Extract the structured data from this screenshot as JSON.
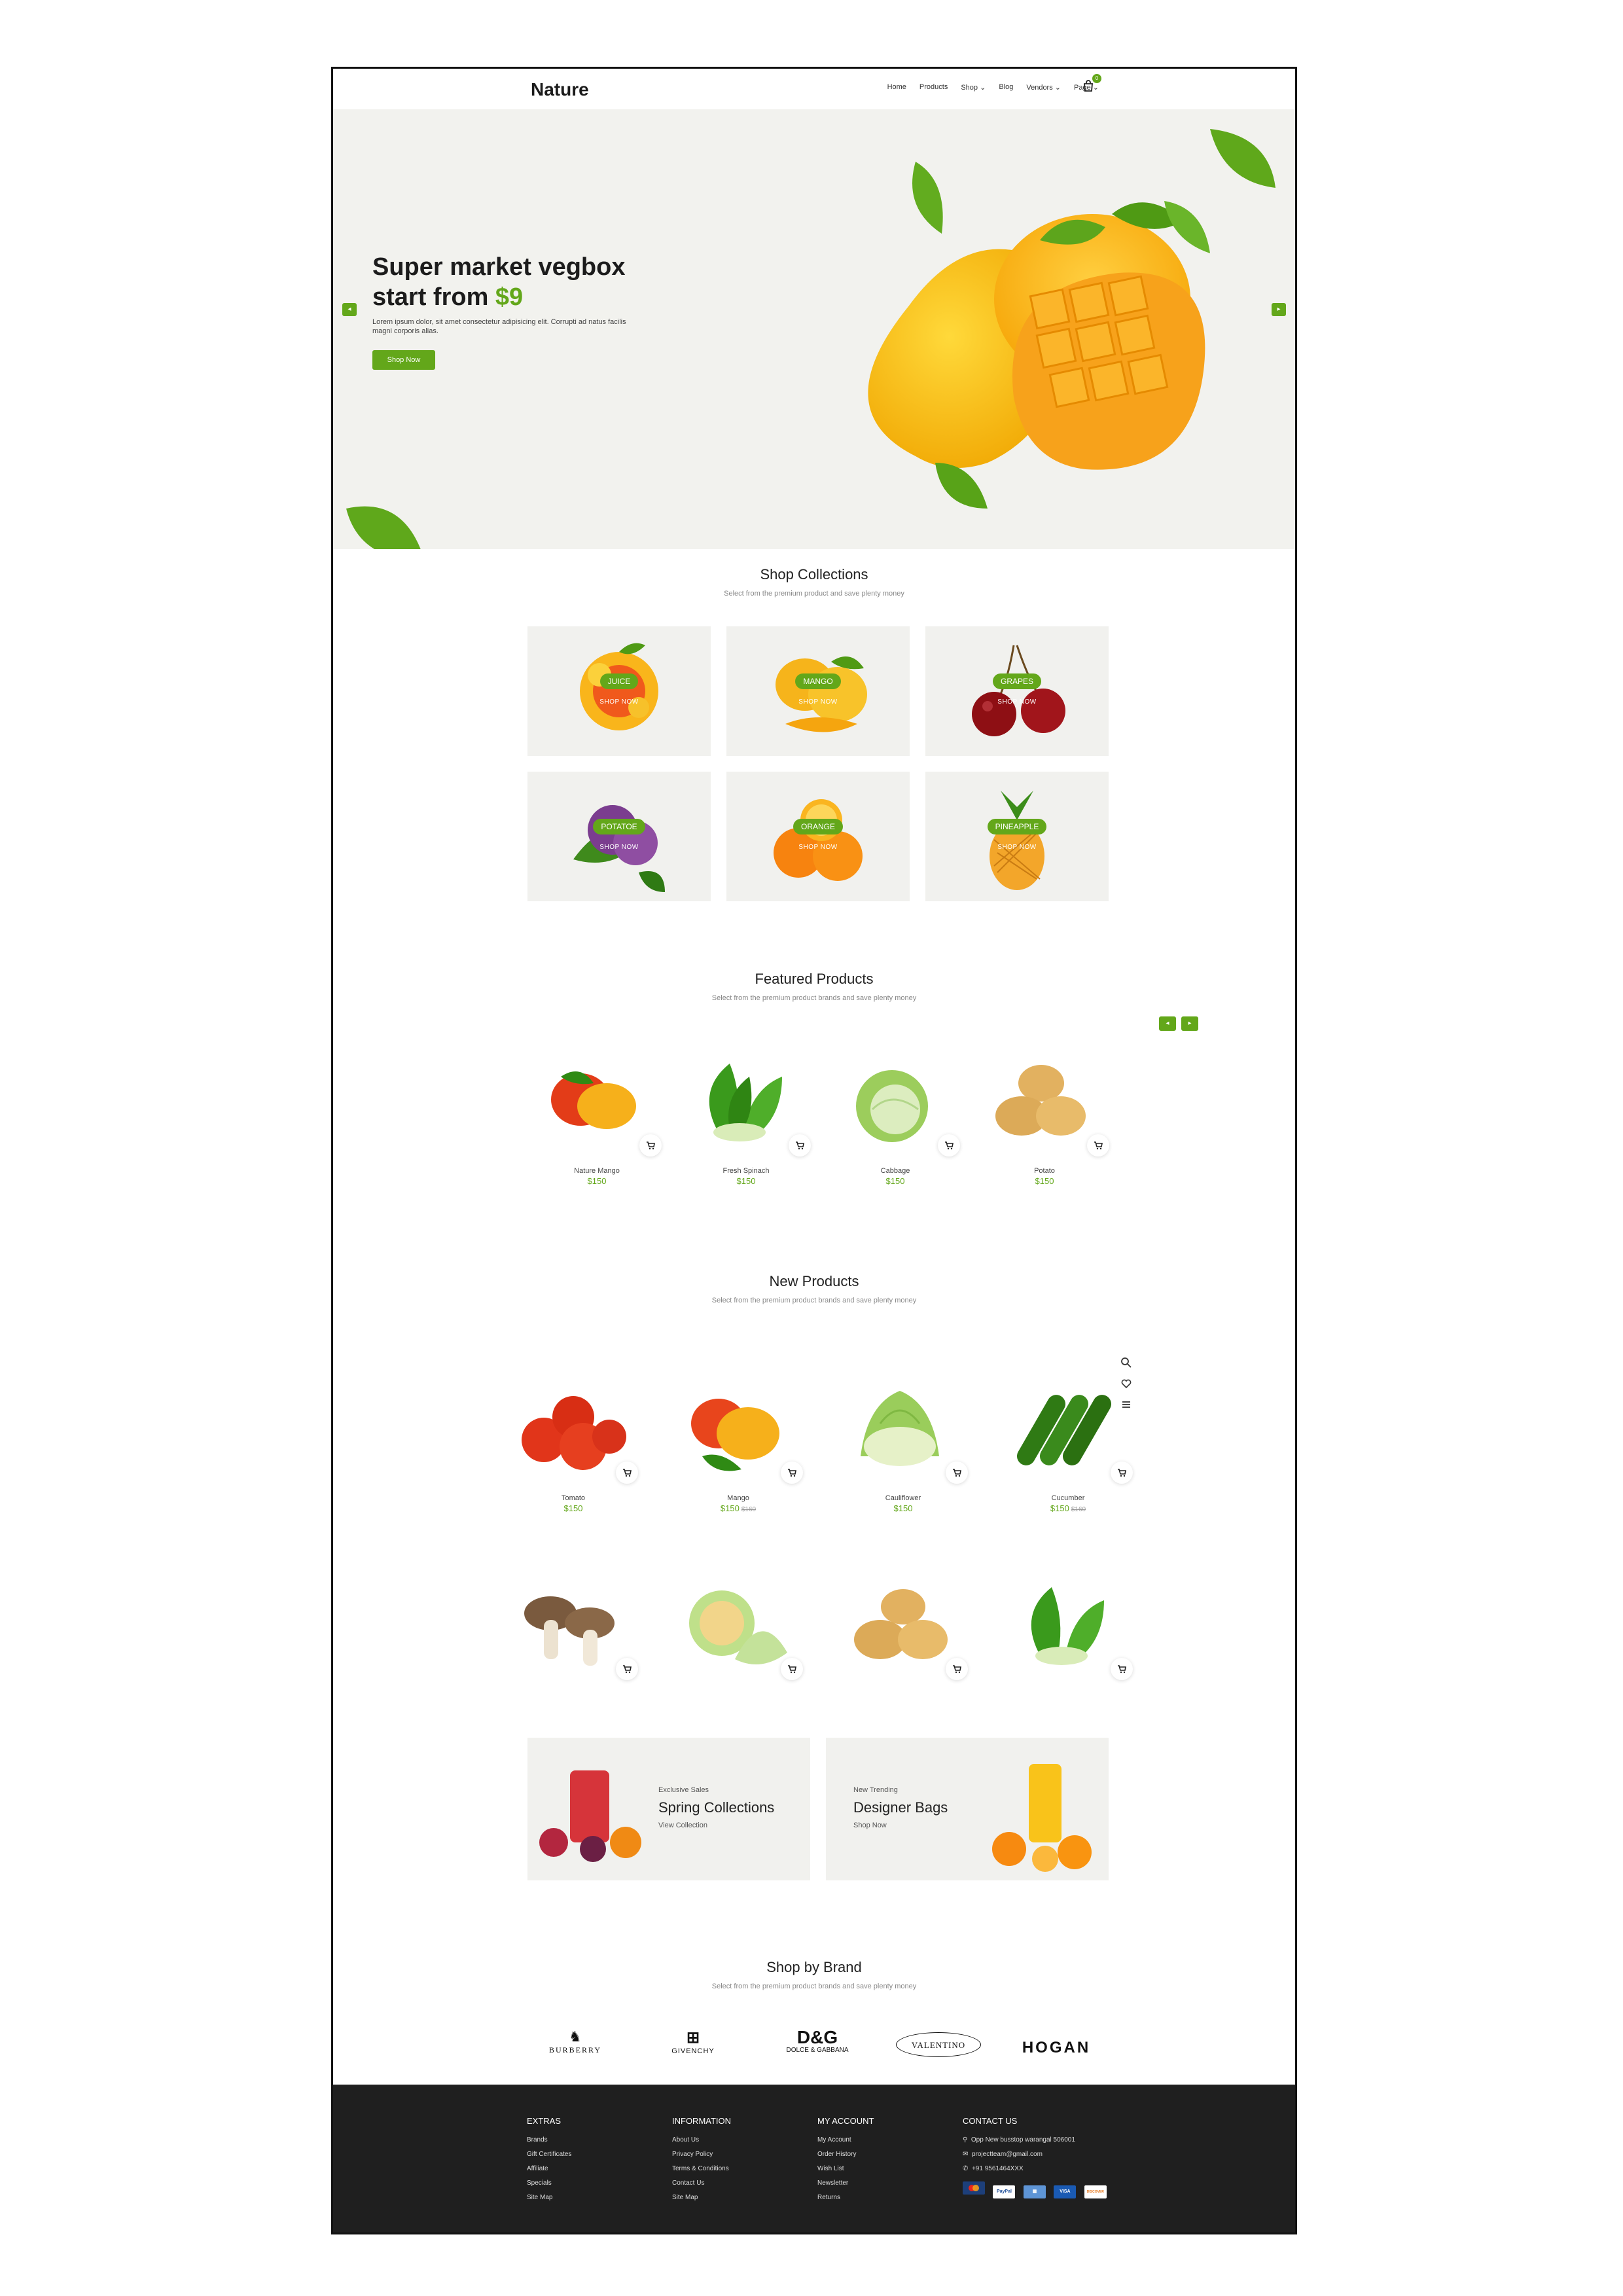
{
  "header": {
    "logo": "Nature",
    "nav": [
      "Home",
      "Products",
      "Shop",
      "Blog",
      "Vendors",
      "Page"
    ],
    "cart_count": "0"
  },
  "hero": {
    "title_line1": "Super market vegbox",
    "title_line2": "start from ",
    "title_price": "$9",
    "text": "Lorem ipsum dolor, sit amet consectetur adipisicing elit. Corrupti ad natus facilis magni corporis alias.",
    "button": "Shop Now"
  },
  "collections": {
    "title": "Shop Collections",
    "subtitle": "Select from the premium product and save plenty money",
    "items": [
      {
        "name": "JUICE",
        "cta": "SHOP NOW"
      },
      {
        "name": "MANGO",
        "cta": "SHOP NOW"
      },
      {
        "name": "GRAPES",
        "cta": "SHOP NOW"
      },
      {
        "name": "POTATOE",
        "cta": "SHOP NOW"
      },
      {
        "name": "ORANGE",
        "cta": "SHOP NOW"
      },
      {
        "name": "PINEAPPLE",
        "cta": "SHOP NOW"
      }
    ]
  },
  "featured": {
    "title": "Featured Products",
    "subtitle": "Select from the premium product brands and save plenty money",
    "items": [
      {
        "name": "Nature Mango",
        "price": "$150"
      },
      {
        "name": "Fresh Spinach",
        "price": "$150"
      },
      {
        "name": "Cabbage",
        "price": "$150"
      },
      {
        "name": "Potato",
        "price": "$150"
      }
    ]
  },
  "new_products": {
    "title": "New Products",
    "subtitle": "Select from the premium product brands and save plenty money",
    "items": [
      {
        "name": "Tomato",
        "price": "$150",
        "old": ""
      },
      {
        "name": "Mango",
        "price": "$150",
        "old": "$160"
      },
      {
        "name": "Cauliflower",
        "price": "$150",
        "old": ""
      },
      {
        "name": "Cucumber",
        "price": "$150",
        "old": "$160"
      }
    ]
  },
  "banners": [
    {
      "small": "Exclusive Sales",
      "big": "Spring Collections",
      "link": "View Collection"
    },
    {
      "small": "New Trending",
      "big": "Designer Bags",
      "link": "Shop Now"
    }
  ],
  "brands": {
    "title": "Shop by Brand",
    "subtitle": "Select from the premium product brands and save plenty money",
    "items": [
      "BURBERRY",
      "GIVENCHY",
      "D&G",
      "DOLCE & GABBANA",
      "VALENTINO",
      "HOGAN"
    ]
  },
  "footer": {
    "extras": {
      "title": "EXTRAS",
      "items": [
        "Brands",
        "Gift Certificates",
        "Affiliate",
        "Specials",
        "Site Map"
      ]
    },
    "information": {
      "title": "INFORMATION",
      "items": [
        "About Us",
        "Privacy Policy",
        "Terms & Conditions",
        "Contact Us",
        "Site Map"
      ]
    },
    "account": {
      "title": "MY ACCOUNT",
      "items": [
        "My Account",
        "Order History",
        "Wish List",
        "Newsletter",
        "Returns"
      ]
    },
    "contact": {
      "title": "CONTACT US",
      "address": "Opp New busstop warangal 506001",
      "email": "projectteam@gmail.com",
      "phone": "+91 9561464XXX"
    },
    "payments": [
      "PayPal",
      "VISA",
      "DISCOVER"
    ]
  },
  "colors": {
    "accent": "#63a71a",
    "hero_bg": "#f2f2ee",
    "footer_bg": "#1f1f1f"
  }
}
